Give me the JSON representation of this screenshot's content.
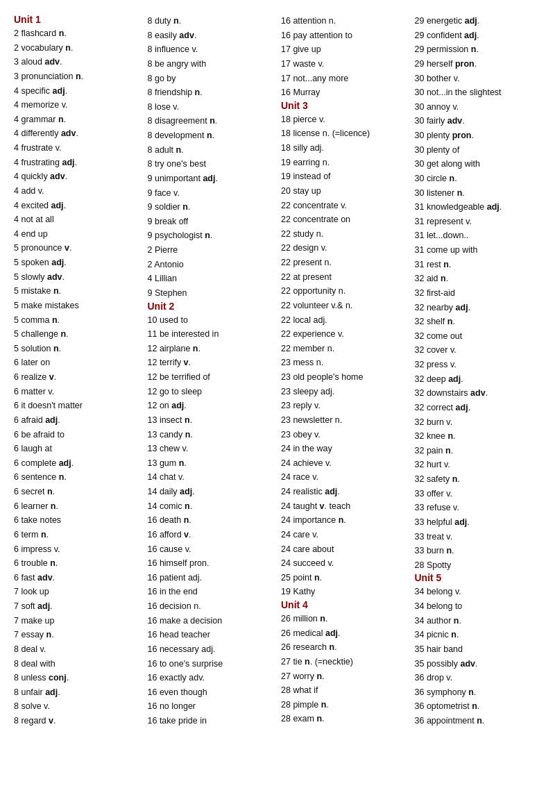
{
  "columns": [
    {
      "items": [
        {
          "type": "unit",
          "text": "Unit 1"
        },
        {
          "text": "2 flashcard <b>n</b>."
        },
        {
          "text": "2 vocabulary <b>n</b>."
        },
        {
          "text": "3 aloud <b>adv</b>."
        },
        {
          "text": "3 pronunciation <b>n</b>."
        },
        {
          "text": "4 specific <b>adj</b>."
        },
        {
          "text": "4 memorize v."
        },
        {
          "text": "4 grammar <b>n</b>."
        },
        {
          "text": "4 differently <b>adv</b>."
        },
        {
          "text": "4 frustrate v."
        },
        {
          "text": "4 frustrating <b>adj</b>."
        },
        {
          "text": "4 quickly <b>adv</b>."
        },
        {
          "text": "4 add v."
        },
        {
          "text": "4 excited <b>adj</b>."
        },
        {
          "text": "4 not at all"
        },
        {
          "text": "4 end up"
        },
        {
          "text": "5 pronounce <b>v</b>."
        },
        {
          "text": "5 spoken <b>adj</b>."
        },
        {
          "text": "5 slowly <b>adv</b>."
        },
        {
          "text": "5 mistake <b>n</b>."
        },
        {
          "text": "5 make mistakes"
        },
        {
          "text": "5 comma <b>n</b>."
        },
        {
          "text": "5 challenge <b>n</b>."
        },
        {
          "text": "5 solution <b>n</b>."
        },
        {
          "text": "6 later on"
        },
        {
          "text": "6 realize <b>v</b>."
        },
        {
          "text": "6 matter v."
        },
        {
          "text": "6 it doesn't matter"
        },
        {
          "text": "6 afraid <b>adj</b>."
        },
        {
          "text": "6 be afraid to"
        },
        {
          "text": "6 laugh at"
        },
        {
          "text": "6 complete <b>adj</b>."
        },
        {
          "text": "6 sentence <b>n</b>."
        },
        {
          "text": "6 secret <b>n</b>."
        },
        {
          "text": "6 learner <b>n</b>."
        },
        {
          "text": "6 take notes"
        },
        {
          "text": "6 term <b>n</b>."
        },
        {
          "text": "6 impress v."
        },
        {
          "text": "6 trouble <b>n</b>."
        },
        {
          "text": "6 fast <b>adv</b>."
        },
        {
          "text": "7 look up"
        },
        {
          "text": "7 soft <b>adj</b>."
        },
        {
          "text": "7 make up"
        },
        {
          "text": "7 essay <b>n</b>."
        },
        {
          "text": "8 deal v."
        },
        {
          "text": "8 deal with"
        },
        {
          "text": "8 unless <b>conj</b>."
        },
        {
          "text": "8 unfair <b>adj</b>."
        },
        {
          "text": "8 solve v."
        },
        {
          "text": "8 regard <b>v</b>."
        }
      ]
    },
    {
      "items": [
        {
          "text": "8 duty <b>n</b>."
        },
        {
          "text": "8 easily <b>adv</b>."
        },
        {
          "text": "8 influence v."
        },
        {
          "text": "8 be angry with"
        },
        {
          "text": "8 go by"
        },
        {
          "text": "8 friendship <b>n</b>."
        },
        {
          "text": "8 lose v."
        },
        {
          "text": "8 disagreement <b>n</b>."
        },
        {
          "text": "8 development <b>n</b>."
        },
        {
          "text": "8 adult <b>n</b>."
        },
        {
          "text": "8 try one's best"
        },
        {
          "text": "9 unimportant <b>adj</b>."
        },
        {
          "text": "9 face v."
        },
        {
          "text": "9 soldier <b>n</b>."
        },
        {
          "text": "9 break off"
        },
        {
          "text": "9 psychologist <b>n</b>."
        },
        {
          "text": "2 Pierre"
        },
        {
          "text": "2 Antonio"
        },
        {
          "text": "4 Lillian"
        },
        {
          "text": "9 Stephen"
        },
        {
          "type": "unit",
          "text": "Unit 2"
        },
        {
          "text": "10 used to"
        },
        {
          "text": "11 be interested in"
        },
        {
          "text": "12 airplane <b>n</b>."
        },
        {
          "text": "12 terrify <b>v</b>."
        },
        {
          "text": "12 be terrified of"
        },
        {
          "text": "12 go to sleep"
        },
        {
          "text": "12 on <b>adj</b>."
        },
        {
          "text": "13 insect <b>n</b>."
        },
        {
          "text": "13 candy <b>n</b>."
        },
        {
          "text": "13 chew v."
        },
        {
          "text": "13 gum <b>n</b>."
        },
        {
          "text": "14 chat v."
        },
        {
          "text": "14 daily <b>adj</b>."
        },
        {
          "text": "14 comic <b>n</b>."
        },
        {
          "text": "16 death <b>n</b>."
        },
        {
          "text": "16 afford <b>v</b>."
        },
        {
          "text": "16 cause v."
        },
        {
          "text": "16 himself pron."
        },
        {
          "text": "16 patient adj."
        },
        {
          "text": "16 in the end"
        },
        {
          "text": "16 decision n."
        },
        {
          "text": "16 make a decision"
        },
        {
          "text": "16 head teacher"
        },
        {
          "text": "16 necessary adj."
        },
        {
          "text": "16 to one's surprise"
        },
        {
          "text": "16 exactly adv."
        },
        {
          "text": "16 even though"
        },
        {
          "text": "16 no longer"
        },
        {
          "text": "16 take pride in"
        }
      ]
    },
    {
      "items": [
        {
          "text": "16 attention n."
        },
        {
          "text": "16 pay attention to"
        },
        {
          "text": "17 give up"
        },
        {
          "text": "17 waste v."
        },
        {
          "text": "17 not...any more"
        },
        {
          "text": "16 Murray"
        },
        {
          "type": "unit",
          "text": "Unit 3"
        },
        {
          "text": "18 pierce v."
        },
        {
          "text": "18 license n. (=licence)"
        },
        {
          "text": "18 silly adj."
        },
        {
          "text": "19 earring n."
        },
        {
          "text": "19 instead of"
        },
        {
          "text": "20 stay up"
        },
        {
          "text": "22 concentrate v."
        },
        {
          "text": "22 concentrate on"
        },
        {
          "text": "22 study n."
        },
        {
          "text": "22 design v."
        },
        {
          "text": "22 present n."
        },
        {
          "text": "22 at present"
        },
        {
          "text": "22 opportunity n."
        },
        {
          "text": "22 volunteer v.&amp; n."
        },
        {
          "text": "22 local adj."
        },
        {
          "text": "22 experience v."
        },
        {
          "text": "22 member n."
        },
        {
          "text": "23 mess n."
        },
        {
          "text": "23 old people's home"
        },
        {
          "text": "23 sleepy adj."
        },
        {
          "text": "23 reply v."
        },
        {
          "text": "23 newsletter n."
        },
        {
          "text": "23 obey v."
        },
        {
          "text": "24 in the way"
        },
        {
          "text": "24 achieve v."
        },
        {
          "text": "24 race v."
        },
        {
          "text": "24 realistic <b>adj</b>."
        },
        {
          "text": "24 taught <b>v</b>. teach"
        },
        {
          "text": "24 importance <b>n</b>."
        },
        {
          "text": "24 care v."
        },
        {
          "text": "24 care about"
        },
        {
          "text": "24 succeed v."
        },
        {
          "text": "25 point <b>n</b>."
        },
        {
          "text": "19 Kathy"
        },
        {
          "type": "unit",
          "text": "Unit 4"
        },
        {
          "text": "26 million <b>n</b>."
        },
        {
          "text": "26 medical <b>adj</b>."
        },
        {
          "text": "26 research <b>n</b>."
        },
        {
          "text": "27 tie <b>n</b>. (=necktie)"
        },
        {
          "text": "27 worry <b>n</b>."
        },
        {
          "text": "28 what if"
        },
        {
          "text": "28 pimple <b>n</b>."
        },
        {
          "text": "28 exam <b>n</b>."
        }
      ]
    },
    {
      "items": [
        {
          "text": "29 energetic <b>adj</b>."
        },
        {
          "text": "29 confident <b>adj</b>."
        },
        {
          "text": "29 permission <b>n</b>."
        },
        {
          "text": "29 herself <b>pron</b>."
        },
        {
          "text": "30 bother v."
        },
        {
          "text": "30 not...in the slightest"
        },
        {
          "text": "30 annoy v."
        },
        {
          "text": "30 fairly <b>adv</b>."
        },
        {
          "text": "30 plenty <b>pron</b>."
        },
        {
          "text": "30 plenty of"
        },
        {
          "text": "30 get along with"
        },
        {
          "text": "30 circle <b>n</b>."
        },
        {
          "text": "30 listener <b>n</b>."
        },
        {
          "text": "31 knowledgeable <b>adj</b>."
        },
        {
          "text": "31 represent v."
        },
        {
          "text": "31 let...down.."
        },
        {
          "text": "31 come up with"
        },
        {
          "text": "31 rest <b>n</b>."
        },
        {
          "text": "32 aid <b>n</b>."
        },
        {
          "text": "32 first-aid"
        },
        {
          "text": "32 nearby <b>adj</b>."
        },
        {
          "text": "32 shelf <b>n</b>."
        },
        {
          "text": "32 come out"
        },
        {
          "text": "32 cover v."
        },
        {
          "text": "32 press v."
        },
        {
          "text": "32 deep <b>adj</b>."
        },
        {
          "text": "32 downstairs <b>adv</b>."
        },
        {
          "text": "32 correct <b>adj</b>."
        },
        {
          "text": "32 burn v."
        },
        {
          "text": "32 knee <b>n</b>."
        },
        {
          "text": "32 pain <b>n</b>."
        },
        {
          "text": "32 hurt v."
        },
        {
          "text": "32 safety <b>n</b>."
        },
        {
          "text": "33 offer v."
        },
        {
          "text": "33 refuse v."
        },
        {
          "text": "33 helpful <b>adj</b>."
        },
        {
          "text": "33 treat v."
        },
        {
          "text": "33 burn <b>n</b>."
        },
        {
          "text": "28 Spotty"
        },
        {
          "type": "unit",
          "text": "Unit 5"
        },
        {
          "text": "34 belong v."
        },
        {
          "text": "34 belong to"
        },
        {
          "text": "34 author <b>n</b>."
        },
        {
          "text": "34 picnic <b>n</b>."
        },
        {
          "text": "35 hair band"
        },
        {
          "text": "35 possibly <b>adv</b>."
        },
        {
          "text": "36 drop v."
        },
        {
          "text": "36 symphony <b>n</b>."
        },
        {
          "text": "36 optometrist <b>n</b>."
        },
        {
          "text": "36 appointment <b>n</b>."
        }
      ]
    }
  ]
}
